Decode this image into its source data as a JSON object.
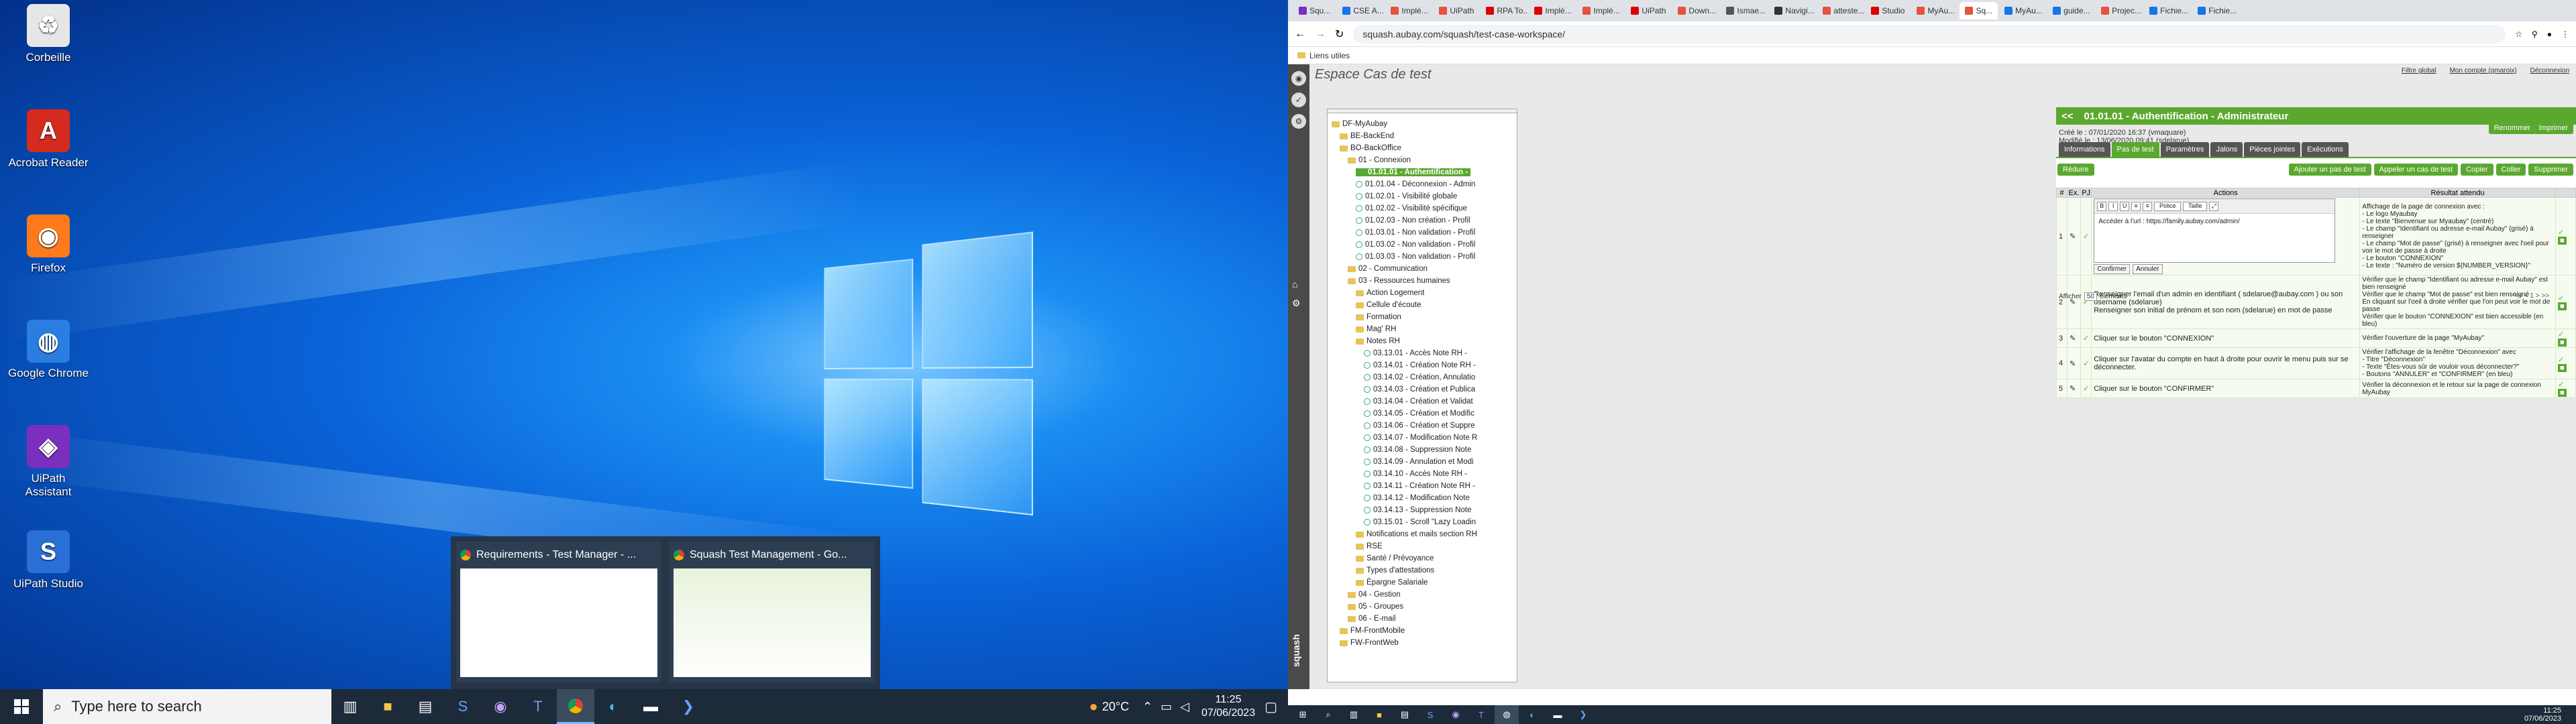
{
  "desktop_icons": [
    {
      "label": "Corbeille",
      "icon": "recycle-bin-icon"
    },
    {
      "label": "Acrobat Reader",
      "icon": "acrobat-icon"
    },
    {
      "label": "Firefox",
      "icon": "firefox-icon"
    },
    {
      "label": "Google Chrome",
      "icon": "chrome-icon"
    },
    {
      "label": "UiPath Assistant",
      "icon": "uipath-assistant-icon"
    },
    {
      "label": "UiPath Studio",
      "icon": "uipath-studio-icon"
    }
  ],
  "taskbar_left": {
    "search_placeholder": "Type here to search",
    "weather": "20°C",
    "time": "11:25",
    "date": "07/06/2023"
  },
  "thumbnails": [
    {
      "title": "Requirements - Test Manager - ..."
    },
    {
      "title": "Squash Test Management - Go..."
    }
  ],
  "browser": {
    "tabs": [
      "Squ...",
      "CSE A...",
      "Implé...",
      "UiPath",
      "RPA To...",
      "Implé...",
      "Implé...",
      "UiPath",
      "Down...",
      "Ismae...",
      "Navigi...",
      "atteste...",
      "Studio",
      "MyAu...",
      "Sq...",
      "MyAu...",
      "guide...",
      "Projec...",
      "Fichie...",
      "Fichie..."
    ],
    "url": "squash.aubay.com/squash/test-case-workspace/",
    "bookmark": "Liens utiles"
  },
  "squash": {
    "workspace_title": "Espace Cas de test",
    "top_links": [
      "Filtre global",
      "Mon compte (qmaroix)",
      "Déconnexion"
    ],
    "header_title": "01.01.01 - Authentification - Administrateur",
    "created": "Créé le : 07/01/2020 16:37 (vmaquare)",
    "modified": "Modifié le : 13/06/2020 09:41 (sdelarue)",
    "rename_button": "Renommer",
    "print_button": "Imprimer",
    "tabs": [
      "Informations",
      "Pas de test",
      "Paramètres",
      "Jalons",
      "Pièces jointes",
      "Exécutions"
    ],
    "active_tab": "Pas de test",
    "reduce_button": "Réduire",
    "actions": [
      "Ajouter un pas de test",
      "Appeler un cas de test",
      "Copier",
      "Coller",
      "Supprimer"
    ],
    "columns": [
      "#",
      "Ex.",
      "PJ",
      "Actions",
      "Résultat attendu"
    ],
    "editor_toolbar": {
      "font": "Police",
      "size": "Taille"
    },
    "confirm_button": "Confirmer",
    "cancel_button": "Annuler",
    "steps": [
      {
        "num": "1",
        "action": "Accéder à l'url : https://family.aubay.com/admin/",
        "result": "Affichage de la page de connexion avec :\n- Le logo Myaubay\n- Le texte \"Bienvenue sur Myaubay\" (centré)\n- Le champ \"Identifiant ou adresse e-mail Aubay\" (grisé) à renseigner\n- Le champ \"Mot de passe\" (grisé) à renseigner avec l'oeil pour voir le mot de passe à droite\n- Le bouton \"CONNEXION\"\n- Le texte : \"Numéro de version ${NUMBER_VERSION}\""
      },
      {
        "num": "2",
        "action": "Renseigner l'email d'un admin en identifiant ( sdelarue@aubay.com ) ou son username (sdelarue)\nRenseigner son initial de prénom et son nom (sdelarue) en mot de passe",
        "result": "Vérifier que le champ \"Identifiant ou adresse e-mail Aubay\" est bien renseigné\nVérifier que le champ \"Mot de passe\" est bien renseigné\nEn cliquant sur l'oeil à droite vérifier que l'on peut voir le mot de passe\nVérifier que le bouton \"CONNEXION\" est bien accessible (en bleu)"
      },
      {
        "num": "3",
        "action": "Cliquer sur le bouton \"CONNEXION\"",
        "result": "Vérifier l'ouverture de la page \"MyAubay\""
      },
      {
        "num": "4",
        "action": "Cliquer sur l'avatar du compte en haut à droite pour ouvrir le menu puis sur se déconnecter.",
        "result": "Vérifier l'affichage de la fenêtre \"Déconnexion\" avec\n- Titre \"Déconnexion\"\n- Texte \"Êtes-vous sûr de vouloir vous déconnecter?\"\n- Boutons \"ANNULER\" et \"CONFIRMER\" (en bleu)"
      },
      {
        "num": "5",
        "action": "Cliquer sur le bouton \"CONFIRMER\"",
        "result": "Vérifier la déconnexion et le retour sur la page de connexion MyAubay"
      }
    ],
    "pager": {
      "show": "Afficher",
      "count": "50",
      "suffix": "éléments",
      "nav": "<< < 1 > >>"
    },
    "tree": [
      {
        "label": "DF-MyAubay",
        "depth": 0,
        "type": "folder"
      },
      {
        "label": "BE-BackEnd",
        "depth": 1,
        "type": "folder"
      },
      {
        "label": "BO-BackOffice",
        "depth": 1,
        "type": "folder"
      },
      {
        "label": "01 - Connexion",
        "depth": 2,
        "type": "folder"
      },
      {
        "label": "01.01.01 - Authentification -",
        "depth": 3,
        "type": "case",
        "selected": true
      },
      {
        "label": "01.01.04 - Déconnexion - Admin",
        "depth": 3,
        "type": "case"
      },
      {
        "label": "01.02.01 - Visibilité globale",
        "depth": 3,
        "type": "case"
      },
      {
        "label": "01.02.02 - Visibilité spécifique",
        "depth": 3,
        "type": "case"
      },
      {
        "label": "01.02.03 - Non création - Profil",
        "depth": 3,
        "type": "case"
      },
      {
        "label": "01.03.01 - Non validation - Profil",
        "depth": 3,
        "type": "case"
      },
      {
        "label": "01.03.02 - Non validation - Profil",
        "depth": 3,
        "type": "case"
      },
      {
        "label": "01.03.03 - Non validation - Profil",
        "depth": 3,
        "type": "case"
      },
      {
        "label": "02 - Communication",
        "depth": 2,
        "type": "folder"
      },
      {
        "label": "03 - Ressources humaines",
        "depth": 2,
        "type": "folder"
      },
      {
        "label": "Action Logement",
        "depth": 3,
        "type": "folder"
      },
      {
        "label": "Cellule d'écoute",
        "depth": 3,
        "type": "folder"
      },
      {
        "label": "Formation",
        "depth": 3,
        "type": "folder"
      },
      {
        "label": "Mag' RH",
        "depth": 3,
        "type": "folder"
      },
      {
        "label": "Notes RH",
        "depth": 3,
        "type": "folder"
      },
      {
        "label": "03.13.01 - Accès Note RH -",
        "depth": 4,
        "type": "case"
      },
      {
        "label": "03.14.01 - Création Note RH -",
        "depth": 4,
        "type": "case"
      },
      {
        "label": "03.14.02 - Création, Annulatio",
        "depth": 4,
        "type": "case"
      },
      {
        "label": "03.14.03 - Création et Publica",
        "depth": 4,
        "type": "case"
      },
      {
        "label": "03.14.04 - Création et Validat",
        "depth": 4,
        "type": "case"
      },
      {
        "label": "03.14.05 - Création et Modific",
        "depth": 4,
        "type": "case"
      },
      {
        "label": "03.14.06 - Création et Suppre",
        "depth": 4,
        "type": "case"
      },
      {
        "label": "03.14.07 - Modification Note R",
        "depth": 4,
        "type": "case"
      },
      {
        "label": "03.14.08 - Suppression Note",
        "depth": 4,
        "type": "case"
      },
      {
        "label": "03.14.09 - Annulation et Modi",
        "depth": 4,
        "type": "case"
      },
      {
        "label": "03.14.10 - Accès Note RH -",
        "depth": 4,
        "type": "case"
      },
      {
        "label": "03.14.11 - Création Note RH -",
        "depth": 4,
        "type": "case"
      },
      {
        "label": "03.14.12 - Modification Note",
        "depth": 4,
        "type": "case"
      },
      {
        "label": "03.14.13 - Suppression Note",
        "depth": 4,
        "type": "case"
      },
      {
        "label": "03.15.01 - Scroll \"Lazy Loadin",
        "depth": 4,
        "type": "case"
      },
      {
        "label": "Notifications et mails section RH",
        "depth": 3,
        "type": "folder"
      },
      {
        "label": "RSE",
        "depth": 3,
        "type": "folder"
      },
      {
        "label": "Santé / Prévoyance",
        "depth": 3,
        "type": "folder"
      },
      {
        "label": "Types d'attestations",
        "depth": 3,
        "type": "folder"
      },
      {
        "label": "Épargne Salariale",
        "depth": 3,
        "type": "folder"
      },
      {
        "label": "04 - Gestion",
        "depth": 2,
        "type": "folder"
      },
      {
        "label": "05 - Groupes",
        "depth": 2,
        "type": "folder"
      },
      {
        "label": "06 - E-mail",
        "depth": 2,
        "type": "folder"
      },
      {
        "label": "FM-FrontMobile",
        "depth": 1,
        "type": "folder"
      },
      {
        "label": "FW-FrontWeb",
        "depth": 1,
        "type": "folder"
      }
    ],
    "brand": "squash",
    "taskbar_time": "11:25",
    "taskbar_date": "07/06/2023"
  }
}
